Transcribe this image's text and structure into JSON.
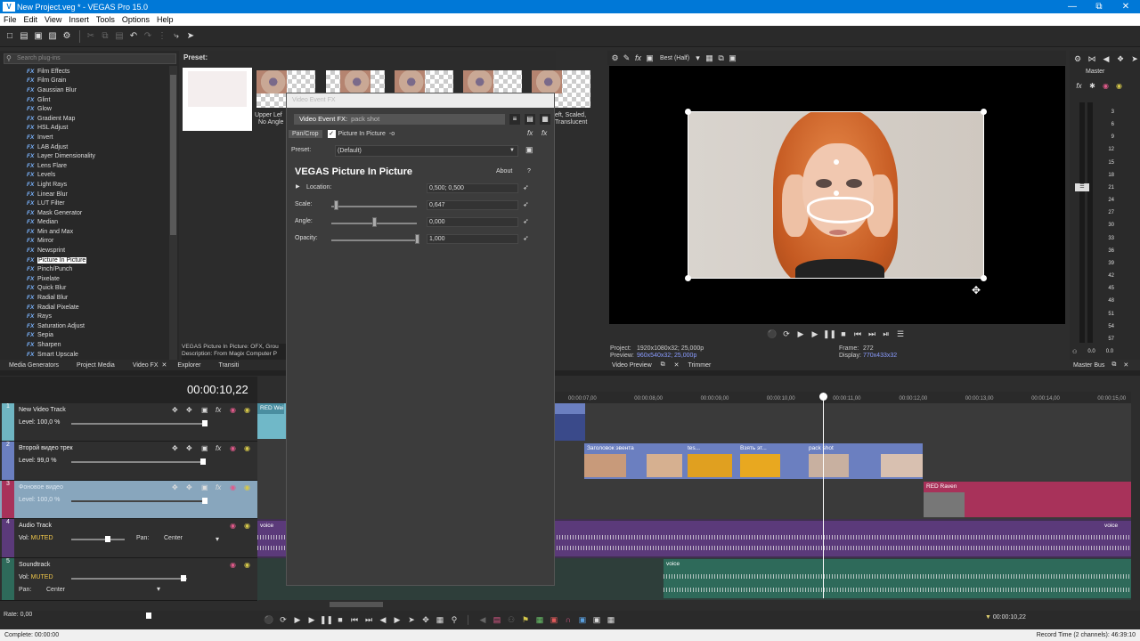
{
  "window": {
    "title": "New Project.veg * - VEGAS Pro 15.0",
    "icon": "V"
  },
  "menu": [
    "File",
    "Edit",
    "View",
    "Insert",
    "Tools",
    "Options",
    "Help"
  ],
  "plugins": {
    "search_placeholder": "Search plug-ins",
    "fx_tag": "FX",
    "items": [
      "Film Effects",
      "Film Grain",
      "Gaussian Blur",
      "Glint",
      "Glow",
      "Gradient Map",
      "HSL Adjust",
      "Invert",
      "LAB Adjust",
      "Layer Dimensionality",
      "Lens Flare",
      "Levels",
      "Light Rays",
      "Linear Blur",
      "LUT Filter",
      "Mask Generator",
      "Median",
      "Min and Max",
      "Mirror",
      "Newsprint",
      "Picture In Picture",
      "Pinch/Punch",
      "Pixelate",
      "Quick Blur",
      "Radial Blur",
      "Radial Pixelate",
      "Rays",
      "Saturation Adjust",
      "Sepia",
      "Sharpen",
      "Smart Upscale"
    ],
    "selected": "Picture In Picture",
    "description_1": "VEGAS Picture In Picture: OFX, Grou",
    "description_2": "Description: From Magix Computer P"
  },
  "preset_panel": {
    "label": "Preset:",
    "caption_left_1": "Upper Lef",
    "caption_left_2": "No Angle",
    "caption_right_1": "eft, Scaled,",
    "caption_right_2": "Translucent"
  },
  "left_tabs": [
    "Media Generators",
    "Project Media",
    "Video FX",
    "Explorer",
    "Transiti"
  ],
  "fx_dialog": {
    "window_title": "Video Event FX",
    "chain_label": "Video Event FX:",
    "chain_event": "pack shot",
    "tab_pancrop": "Pan/Crop",
    "tab_plugin": "Picture In Picture",
    "preset_label": "Preset:",
    "preset_value": "(Default)",
    "plugin_title": "VEGAS Picture In Picture",
    "about": "About",
    "help": "?",
    "params": [
      {
        "name": "Location:",
        "value": "0,500; 0,500",
        "level": null
      },
      {
        "name": "Scale:",
        "value": "0,647",
        "level": 0.05
      },
      {
        "name": "Angle:",
        "value": "0,000",
        "level": 0.5
      },
      {
        "name": "Opacity:",
        "value": "1,000",
        "level": 1.0
      }
    ]
  },
  "preview": {
    "quality": "Best (Half)",
    "project_label": "Project:",
    "project_value": "1920x1080x32; 25,000p",
    "preview_label": "Preview:",
    "preview_value": "960x540x32; 25,000p",
    "frame_label": "Frame:",
    "frame_value": "272",
    "display_label": "Display:",
    "display_value": "770x433x32",
    "tabs": [
      "Video Preview",
      "Trimmer"
    ]
  },
  "master": {
    "label": "Master",
    "scale": [
      "3",
      "6",
      "9",
      "12",
      "15",
      "18",
      "21",
      "24",
      "27",
      "30",
      "33",
      "36",
      "39",
      "42",
      "45",
      "48",
      "51",
      "54",
      "57"
    ],
    "bottom_left": "0.0",
    "bottom_right": "0.0",
    "bus_tab": "Master Bus"
  },
  "timeline": {
    "timecode": "00:00:10,22",
    "ruler": [
      "00:00:07,00",
      "00:00:08,00",
      "00:00:09,00",
      "00:00:10,00",
      "00:00:11,00",
      "00:00:12,00",
      "00:00:13,00",
      "00:00:14,00",
      "00:00:15,00"
    ],
    "playhead_seconds": 10.88,
    "tracks": [
      {
        "num": "1",
        "name": "New Video Track",
        "level_label": "Level:",
        "level": "100,0 %"
      },
      {
        "num": "2",
        "name": "Второй видео трек",
        "level_label": "Level:",
        "level": "99,0 %"
      },
      {
        "num": "3",
        "name": "Фоновое видео",
        "level_label": "Level:",
        "level": "100,0 %"
      },
      {
        "num": "4",
        "name": "Audio Track",
        "vol_label": "Vol:",
        "vol": "MUTED",
        "pan_label": "Pan:",
        "pan": "Center"
      },
      {
        "num": "5",
        "name": "Soundtrack",
        "vol_label": "Vol:",
        "vol": "MUTED",
        "pan_label": "Pan:",
        "pan": "Center"
      }
    ],
    "clips": {
      "track1_left": "RED Wei",
      "track2_c1": "Заголовок эвента",
      "track2_c2": "tes...",
      "track2_c3": "Взять эт...",
      "track2_c4": "pack shot",
      "track3_c1": "RED Raven",
      "audio1": "voice",
      "audio1_right": "voice",
      "audio2": "voice"
    },
    "rate": "Rate: 0,00",
    "cursor_time": "00:00:10,22",
    "record_time": "Record Time (2 channels): 46:39:10"
  },
  "status": {
    "left": "Complete: 00:00:00"
  },
  "colors": {
    "accent": "#0078d7",
    "track_video_1": "#70b8c8",
    "track_video_2": "#6b7fc0",
    "track_video_3": "#a8325a",
    "audio_1": "#5b3a7a",
    "audio_2": "#2e6a5a"
  }
}
